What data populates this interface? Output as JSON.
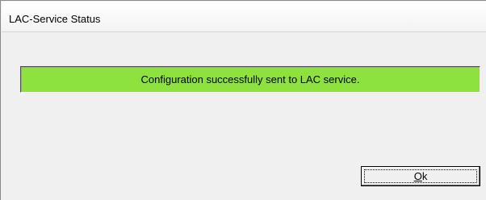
{
  "window": {
    "title": "LAC-Service Status"
  },
  "status": {
    "message": "Configuration successfully sent to LAC service.",
    "color": "#8ee23d"
  },
  "ok_button": {
    "mnemonic": "O",
    "rest": "k"
  }
}
